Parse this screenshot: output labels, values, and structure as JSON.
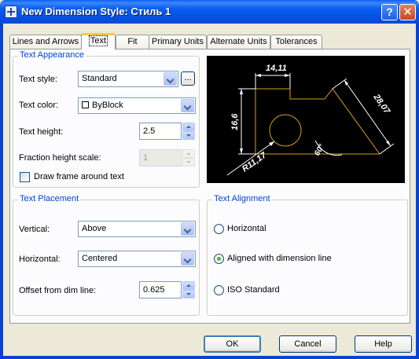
{
  "window": {
    "title": "New Dimension Style: Стиль 1"
  },
  "tabs": [
    {
      "label": "Lines and Arrows",
      "active": false
    },
    {
      "label": "Text",
      "active": true
    },
    {
      "label": "Fit",
      "active": false
    },
    {
      "label": "Primary Units",
      "active": false
    },
    {
      "label": "Alternate Units",
      "active": false
    },
    {
      "label": "Tolerances",
      "active": false
    }
  ],
  "text_appearance": {
    "legend": "Text Appearance",
    "style_label": "Text style:",
    "style_value": "Standard",
    "ellipsis_label": "...",
    "color_label": "Text color:",
    "color_value": "ByBlock",
    "height_label": "Text height:",
    "height_value": "2.5",
    "fraction_label": "Fraction height scale:",
    "fraction_value": "1",
    "frame_label": "Draw frame around text",
    "frame_checked": false
  },
  "preview": {
    "dim_top": "14,11",
    "dim_left": "16,6",
    "dim_right": "28,07",
    "dim_radius": "R11,17",
    "dim_angle": "60°",
    "color_lines": "#ffffff",
    "color_geometry": "#d4a017"
  },
  "text_placement": {
    "legend": "Text Placement",
    "vertical_label": "Vertical:",
    "vertical_value": "Above",
    "horizontal_label": "Horizontal:",
    "horizontal_value": "Centered",
    "offset_label": "Offset from dim line:",
    "offset_value": "0.625"
  },
  "text_alignment": {
    "legend": "Text Alignment",
    "options": [
      {
        "label": "Horizontal",
        "selected": false
      },
      {
        "label": "Aligned with dimension line",
        "selected": true
      },
      {
        "label": "ISO Standard",
        "selected": false
      }
    ]
  },
  "buttons": {
    "ok": "OK",
    "cancel": "Cancel",
    "help": "Help"
  }
}
